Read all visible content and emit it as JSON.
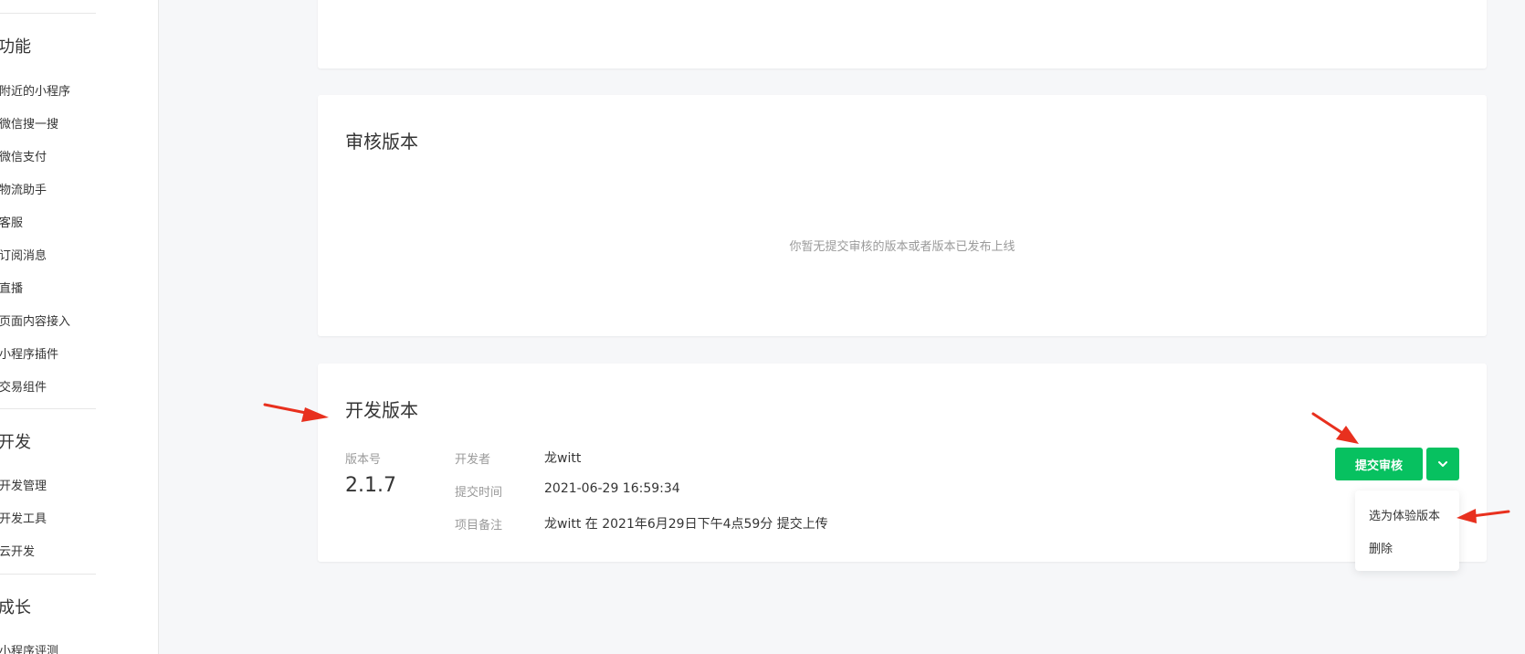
{
  "sidebar": {
    "feature_section": "功能",
    "feature_items": [
      "附近的小程序",
      "微信搜一搜",
      "微信支付",
      "物流助手",
      "客服",
      "订阅消息",
      "直播",
      "页面内容接入",
      "小程序插件",
      "交易组件"
    ],
    "dev_section": "开发",
    "dev_items": [
      "开发管理",
      "开发工具",
      "云开发"
    ],
    "growth_section": "成长",
    "growth_items": [
      "小程序评测"
    ]
  },
  "review_card": {
    "title": "审核版本",
    "empty_message": "你暂无提交审核的版本或者版本已发布上线"
  },
  "dev_card": {
    "title": "开发版本",
    "version_label": "版本号",
    "version_value": "2.1.7",
    "developer_label": "开发者",
    "developer_value": "龙witt",
    "submit_time_label": "提交时间",
    "submit_time_value": "2021-06-29 16:59:34",
    "note_label": "项目备注",
    "note_value": "龙witt 在 2021年6月29日下午4点59分 提交上传",
    "submit_button": "提交审核",
    "dropdown_icon": "chevron-down-icon"
  },
  "dropdown_menu": {
    "items": [
      "选为体验版本",
      "删除"
    ]
  },
  "colors": {
    "accent": "#07c160",
    "annotation": "#e8301e"
  }
}
